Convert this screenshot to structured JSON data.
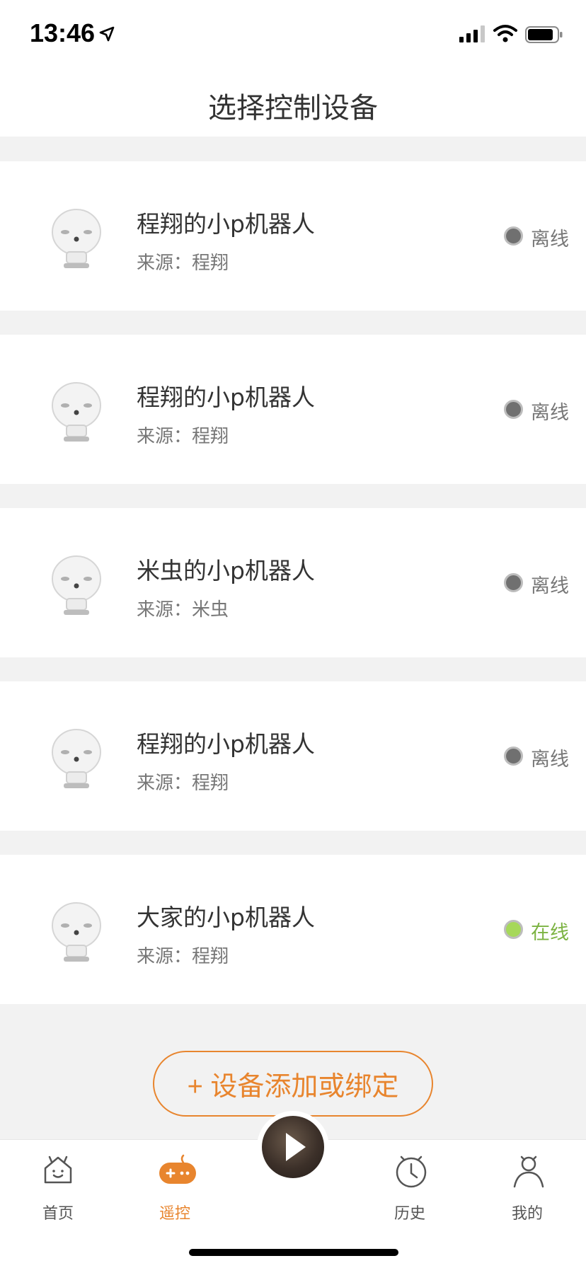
{
  "status_bar": {
    "time": "13:46",
    "icons": [
      "location-arrow-icon",
      "signal-bars-icon",
      "wifi-icon",
      "battery-icon"
    ]
  },
  "header": {
    "title": "选择控制设备"
  },
  "devices": [
    {
      "name": "程翔的小p机器人",
      "source": "来源：程翔",
      "status": "离线",
      "online": false
    },
    {
      "name": "程翔的小p机器人",
      "source": "来源：程翔",
      "status": "离线",
      "online": false
    },
    {
      "name": "米虫的小p机器人",
      "source": "来源：米虫",
      "status": "离线",
      "online": false
    },
    {
      "name": "程翔的小p机器人",
      "source": "来源：程翔",
      "status": "离线",
      "online": false
    },
    {
      "name": "大家的小p机器人",
      "source": "来源：程翔",
      "status": "在线",
      "online": true
    }
  ],
  "add_button": {
    "label": "+ 设备添加或绑定"
  },
  "tabbar": {
    "tabs": [
      {
        "label": "首页",
        "icon": "home-icon",
        "active": false
      },
      {
        "label": "遥控",
        "icon": "gamepad-icon",
        "active": true
      },
      {
        "label": "历史",
        "icon": "clock-icon",
        "active": false
      },
      {
        "label": "我的",
        "icon": "profile-icon",
        "active": false
      }
    ],
    "center_icon": "play-icon"
  },
  "colors": {
    "accent": "#e8852e",
    "offline_dot": "#707070",
    "online_dot": "#a6d85a",
    "online_text": "#7cb342",
    "page_bg": "#f2f2f2"
  }
}
